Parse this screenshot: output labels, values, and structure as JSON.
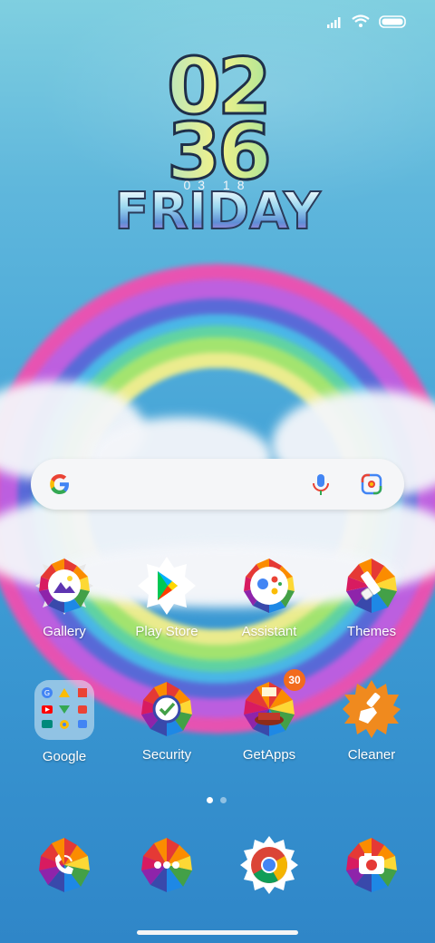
{
  "status_bar": {
    "signal_icon": "signal-icon",
    "wifi_icon": "wifi-icon",
    "battery_icon": "battery-icon"
  },
  "clock": {
    "hour": "02",
    "minute": "36",
    "date": "03 18",
    "day": "FRIDAY"
  },
  "search_bar": {
    "logo": "google-g-icon",
    "mic_icon": "mic-icon",
    "lens_icon": "google-lens-icon"
  },
  "apps_row1": [
    {
      "label": "Gallery",
      "icon": "gallery-icon"
    },
    {
      "label": "Play Store",
      "icon": "play-store-icon"
    },
    {
      "label": "Assistant",
      "icon": "assistant-icon"
    },
    {
      "label": "Themes",
      "icon": "themes-icon"
    }
  ],
  "apps_row2": [
    {
      "label": "Google",
      "icon": "google-folder-icon"
    },
    {
      "label": "Security",
      "icon": "security-icon"
    },
    {
      "label": "GetApps",
      "icon": "getapps-icon",
      "badge": "30"
    },
    {
      "label": "Cleaner",
      "icon": "cleaner-icon"
    }
  ],
  "page_indicator": {
    "pages": 2,
    "active": 1
  },
  "dock": [
    {
      "icon": "phone-icon"
    },
    {
      "icon": "messages-icon"
    },
    {
      "icon": "chrome-icon"
    },
    {
      "icon": "camera-icon"
    }
  ],
  "colors": {
    "accent_orange": "#f26b1d",
    "text": "#ffffff",
    "search_bg": "#f5f6f8"
  }
}
